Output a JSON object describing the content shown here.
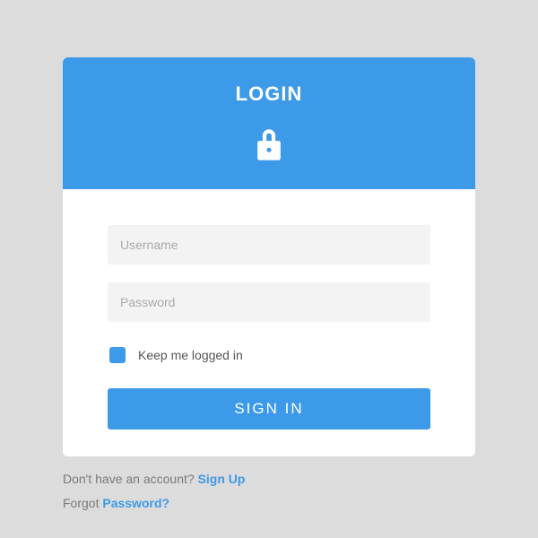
{
  "header": {
    "title": "LOGIN"
  },
  "form": {
    "username_placeholder": "Username",
    "password_placeholder": "Password",
    "checkbox_label": "Keep me logged in",
    "submit_label": "SIGN IN"
  },
  "footer": {
    "signup_prompt": "Don't have an account? ",
    "signup_link": "Sign Up",
    "forgot_prompt": "Forgot ",
    "forgot_link": "Password?"
  },
  "colors": {
    "accent": "#3d9ae8"
  }
}
